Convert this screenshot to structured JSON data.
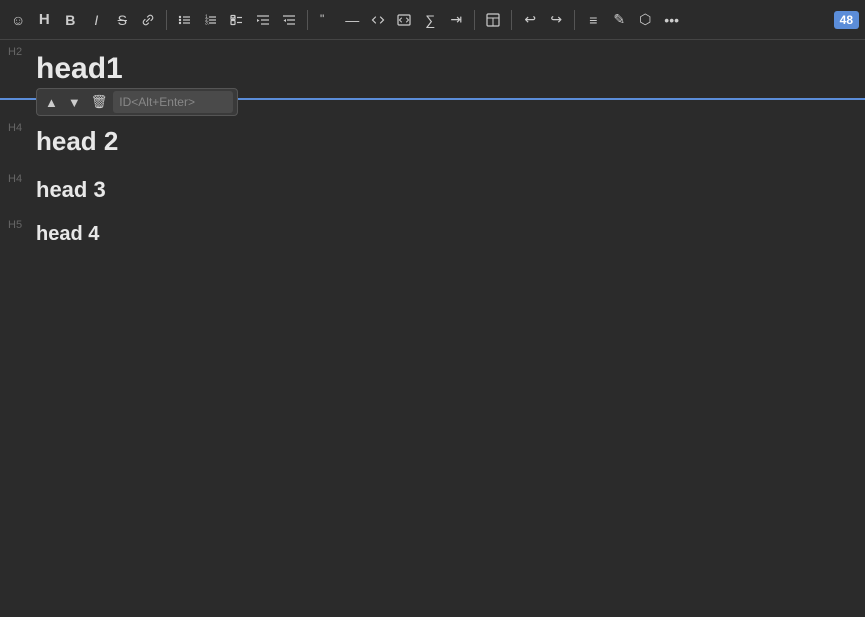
{
  "toolbar": {
    "badge": "48",
    "buttons": [
      {
        "name": "emoji-icon",
        "label": "☺",
        "interactable": true
      },
      {
        "name": "heading-icon",
        "label": "H",
        "interactable": true,
        "bold": true
      },
      {
        "name": "bold-icon",
        "label": "B",
        "interactable": true,
        "bold": true
      },
      {
        "name": "italic-icon",
        "label": "I",
        "interactable": true,
        "italic": true
      },
      {
        "name": "strikethrough-icon",
        "label": "S̶",
        "interactable": true
      },
      {
        "name": "link-icon",
        "label": "⌖",
        "interactable": true
      }
    ]
  },
  "editor": {
    "blocks": [
      {
        "id": "block-head1",
        "level": "H2",
        "text": "head1",
        "selected": true
      },
      {
        "id": "block-head2",
        "level": "H4",
        "text": "head 2"
      },
      {
        "id": "block-head3",
        "level": "H4",
        "text": "head 3"
      },
      {
        "id": "block-head4",
        "level": "H5",
        "text": "head 4"
      }
    ],
    "floating_controls": {
      "up_label": "▲",
      "down_label": "▼",
      "delete_label": "🗑",
      "id_placeholder": "ID<Alt+Enter>"
    }
  }
}
